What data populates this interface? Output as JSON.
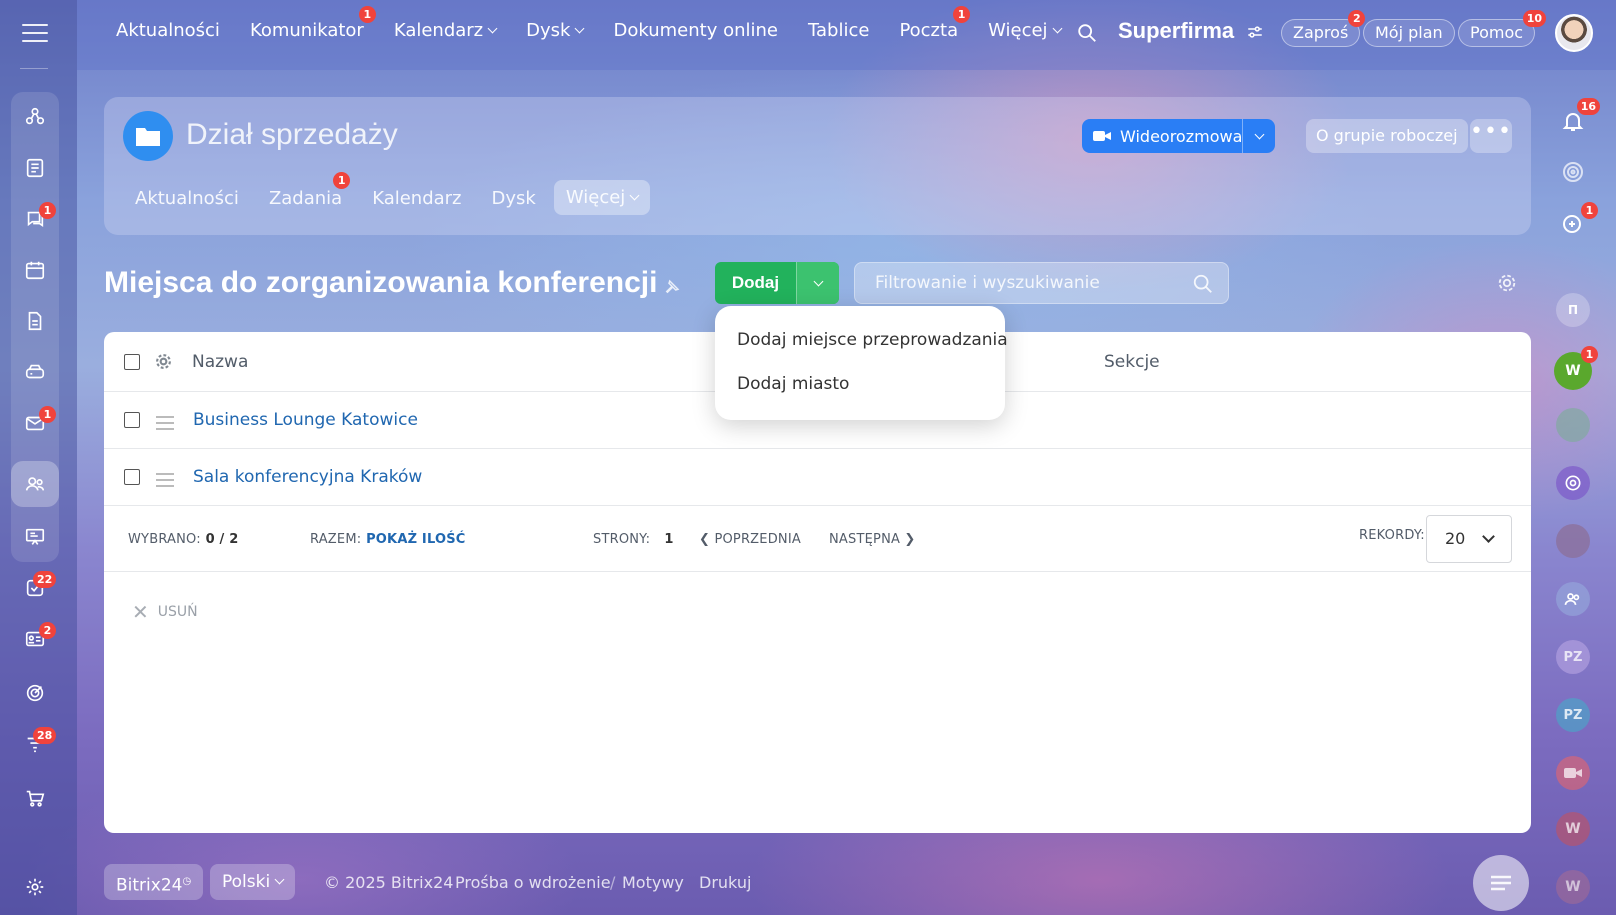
{
  "topnav": {
    "items": [
      {
        "label": "Aktualności",
        "badge": ""
      },
      {
        "label": "Komunikator",
        "badge": "1"
      },
      {
        "label": "Kalendarz",
        "badge": ""
      },
      {
        "label": "Dysk",
        "badge": ""
      },
      {
        "label": "Dokumenty online",
        "badge": ""
      },
      {
        "label": "Tablice",
        "badge": ""
      },
      {
        "label": "Poczta",
        "badge": "1"
      },
      {
        "label": "Więcej",
        "badge": ""
      }
    ],
    "brand": "Superfirma",
    "invite": {
      "label": "Zaproś",
      "badge": "2"
    },
    "myplan": "Mój plan",
    "help": {
      "label": "Pomoc",
      "badge": "10"
    }
  },
  "sidebar": {
    "badges": {
      "chat": "1",
      "mail": "1",
      "tasks": "22",
      "cards": "2",
      "filter": "28"
    }
  },
  "group": {
    "title": "Dział sprzedaży",
    "tabs": [
      {
        "label": "Aktualności",
        "badge": ""
      },
      {
        "label": "Zadania",
        "badge": "1"
      },
      {
        "label": "Kalendarz",
        "badge": ""
      },
      {
        "label": "Dysk",
        "badge": ""
      },
      {
        "label": "Więcej",
        "badge": ""
      }
    ],
    "video_label": "Wideorozmowa",
    "about_label": "O grupie roboczej",
    "more_label": "•••"
  },
  "page": {
    "title": "Miejsca do zorganizowania konferencji",
    "add_label": "Dodaj",
    "filter_placeholder": "Filtrowanie i wyszukiwanie"
  },
  "dropdown": {
    "items": [
      "Dodaj miejsce przeprowadzania",
      "Dodaj miasto"
    ]
  },
  "table": {
    "columns": {
      "name": "Nazwa",
      "sections": "Sekcje"
    },
    "rows": [
      {
        "name": "Business Lounge Katowice"
      },
      {
        "name": "Sala konferencyjna Kraków"
      }
    ],
    "footer": {
      "selected_label": "WYBRANO:",
      "selected_value": "0 / 2",
      "total_label": "RAZEM:",
      "total_value": "POKAŻ ILOŚĆ",
      "pages_label": "STRONY:",
      "pages_value": "1",
      "prev": "POPRZEDNIA",
      "next": "NASTĘPNA",
      "records_label": "REKORDY:",
      "records_value": "20"
    },
    "delete_label": "USUŃ"
  },
  "rightbar": {
    "notifications_badge": "16",
    "chat_badge": "1",
    "w_badge": "1",
    "avatars": [
      "W",
      "PZ",
      "PZ",
      "W",
      "W"
    ]
  },
  "bottom": {
    "bitrix": "Bitrix24",
    "language": "Polski",
    "copyright": "© 2025 Bitrix24",
    "links": [
      "Prośba o wdrożenie",
      "Motywy",
      "Drukuj"
    ]
  }
}
